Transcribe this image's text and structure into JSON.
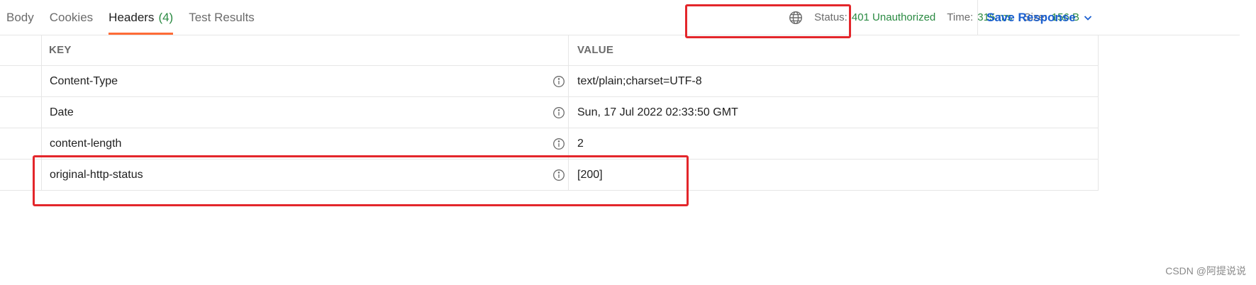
{
  "tabs": [
    {
      "label": "Body"
    },
    {
      "label": "Cookies"
    },
    {
      "label": "Headers",
      "count": "(4)"
    },
    {
      "label": "Test Results"
    }
  ],
  "status": {
    "status_label": "Status:",
    "status_value": "401 Unauthorized",
    "time_label": "Time:",
    "time_value": "315 ms",
    "size_label": "Size:",
    "size_value": "156 B"
  },
  "save_response_label": "Save Response",
  "table": {
    "columns": {
      "key": "KEY",
      "value": "VALUE"
    },
    "rows": [
      {
        "key": "Content-Type",
        "value": "text/plain;charset=UTF-8"
      },
      {
        "key": "Date",
        "value": "Sun, 17 Jul 2022 02:33:50 GMT"
      },
      {
        "key": "content-length",
        "value": "2"
      },
      {
        "key": "original-http-status",
        "value": "[200]"
      }
    ]
  },
  "watermark": "CSDN @阿提说说",
  "colors": {
    "accent_tab": "#ff6c37",
    "success_green": "#2a8a42",
    "link_blue": "#1a5fd0",
    "annotation_red": "#e3262b"
  }
}
